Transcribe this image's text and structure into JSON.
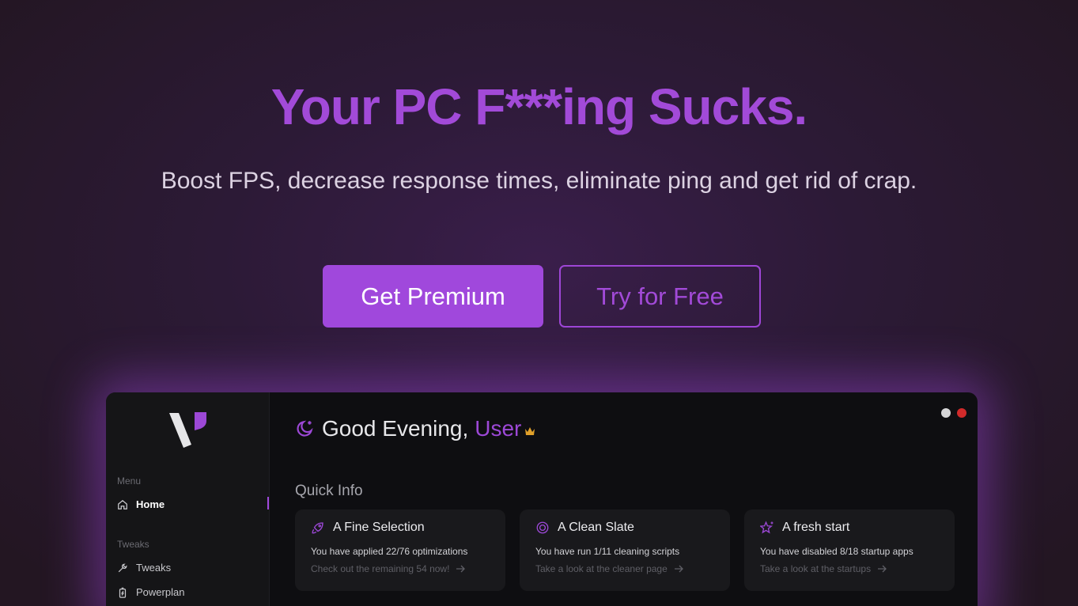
{
  "hero": {
    "title": "Your PC F***ing Sucks.",
    "subtitle": "Boost FPS, decrease response times, eliminate ping and get rid of crap.",
    "primary_button": "Get Premium",
    "secondary_button": "Try for Free"
  },
  "colors": {
    "accent": "#a048dc",
    "app_background": "#0e0e11",
    "crown": "#e0a02a"
  },
  "sidebar": {
    "menu_label": "Menu",
    "menu_items": [
      {
        "label": "Home",
        "icon": "home-icon",
        "active": true
      }
    ],
    "tweaks_label": "Tweaks",
    "tweaks_items": [
      {
        "label": "Tweaks",
        "icon": "wrench-icon"
      },
      {
        "label": "Powerplan",
        "icon": "battery-icon"
      }
    ]
  },
  "main": {
    "greeting": "Good Evening,",
    "user": "User",
    "section_title": "Quick Info",
    "cards": [
      {
        "title": "A Fine Selection",
        "icon": "rocket-icon",
        "line1": "You have applied 22/76 optimizations",
        "line2": "Check out the remaining 54 now!"
      },
      {
        "title": "A Clean Slate",
        "icon": "target-icon",
        "line1": "You have run 1/11 cleaning scripts",
        "line2": "Take a look at the cleaner page"
      },
      {
        "title": "A fresh start",
        "icon": "sparkle-star-icon",
        "line1": "You have disabled 8/18 startup apps",
        "line2": "Take a look at the startups"
      }
    ]
  }
}
